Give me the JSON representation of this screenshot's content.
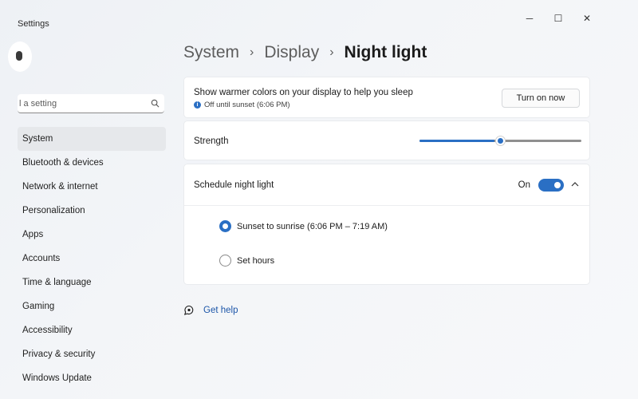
{
  "window": {
    "title": "Settings",
    "controls": {
      "minimize": "─",
      "maximize": "☐",
      "close": "✕"
    }
  },
  "search": {
    "placeholder": "l a setting"
  },
  "sidebar": {
    "items": [
      {
        "label": "System",
        "active": true
      },
      {
        "label": "Bluetooth & devices"
      },
      {
        "label": "Network & internet"
      },
      {
        "label": "Personalization"
      },
      {
        "label": "Apps"
      },
      {
        "label": "Accounts"
      },
      {
        "label": "Time & language"
      },
      {
        "label": "Gaming"
      },
      {
        "label": "Accessibility"
      },
      {
        "label": "Privacy & security"
      },
      {
        "label": "Windows Update"
      }
    ]
  },
  "breadcrumb": {
    "level1": "System",
    "level2": "Display",
    "current": "Night light"
  },
  "night_light": {
    "description": "Show warmer colors on your display to help you sleep",
    "status": "Off until sunset (6:06 PM)",
    "turn_on_label": "Turn on now"
  },
  "strength": {
    "label": "Strength",
    "value_percent": 50
  },
  "schedule": {
    "label": "Schedule night light",
    "toggle_text": "On",
    "toggle_on": true,
    "options": [
      {
        "label": "Sunset to sunrise (6:06 PM – 7:19 AM)",
        "selected": true
      },
      {
        "label": "Set hours",
        "selected": false
      }
    ]
  },
  "help": {
    "label": "Get help"
  },
  "colors": {
    "accent": "#2a6fc4"
  }
}
